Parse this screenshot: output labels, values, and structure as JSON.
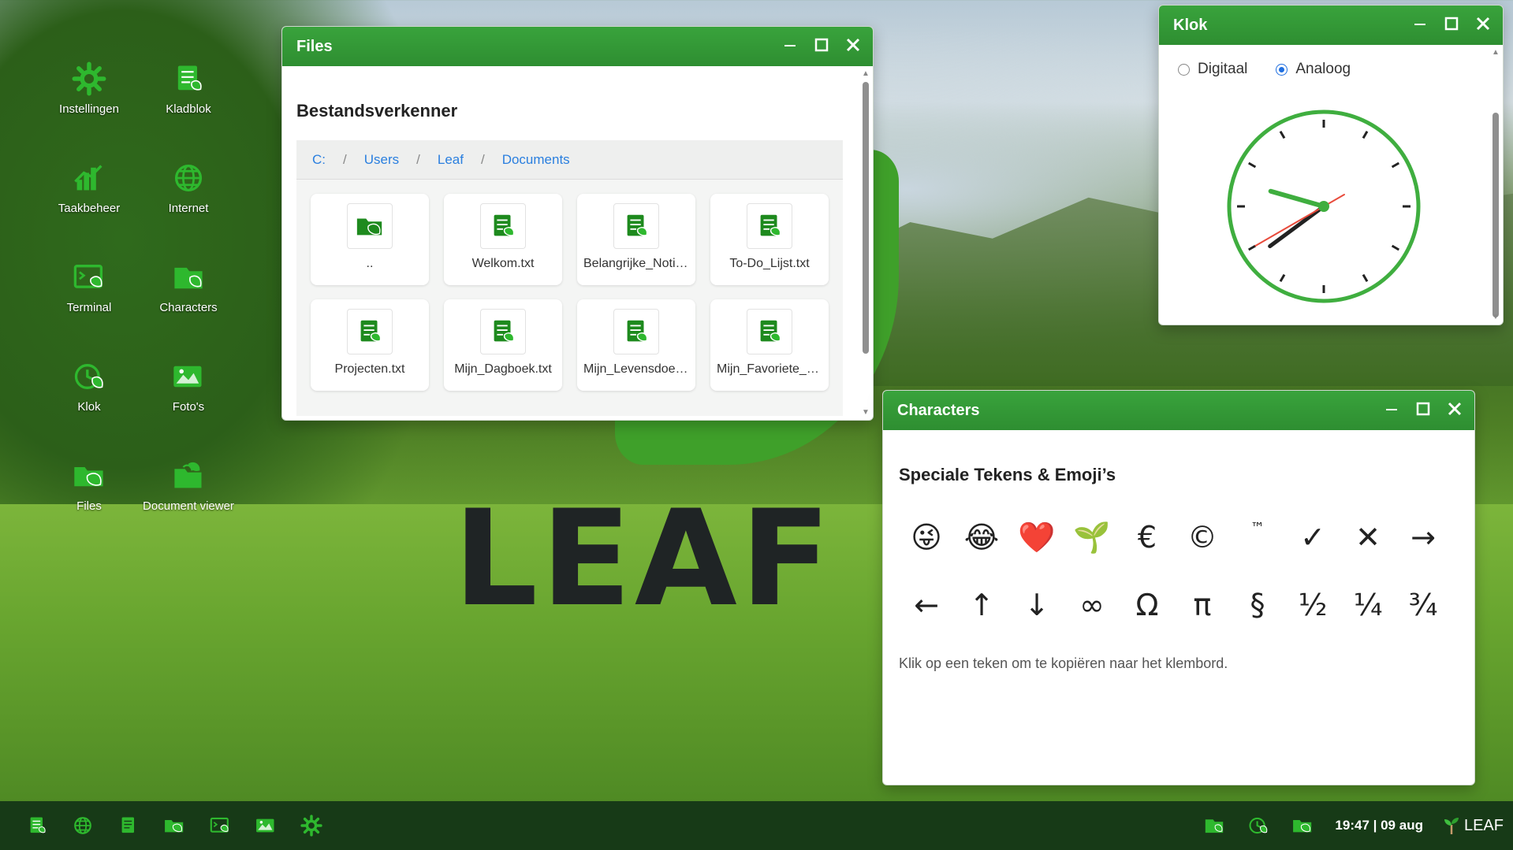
{
  "desktop": {
    "icons": [
      {
        "label": "Instellingen",
        "icon": "gear-icon"
      },
      {
        "label": "Kladblok",
        "icon": "notepad-icon"
      },
      {
        "label": "Taakbeheer",
        "icon": "chart-icon"
      },
      {
        "label": "Internet",
        "icon": "globe-icon"
      },
      {
        "label": "Terminal",
        "icon": "terminal-icon"
      },
      {
        "label": "Characters",
        "icon": "characters-icon"
      },
      {
        "label": "Klok",
        "icon": "clock-icon"
      },
      {
        "label": "Foto's",
        "icon": "photos-icon"
      },
      {
        "label": "Files",
        "icon": "folder-icon"
      },
      {
        "label": "Document viewer",
        "icon": "document-icon"
      }
    ],
    "logo_text": "LEAF O"
  },
  "files_window": {
    "title": "Files",
    "heading": "Bestandsverkenner",
    "breadcrumb": [
      "C:",
      "Users",
      "Leaf",
      "Documents"
    ],
    "items": [
      {
        "name": "..",
        "type": "folder"
      },
      {
        "name": "Welkom.txt",
        "type": "file"
      },
      {
        "name": "Belangrijke_Notities.txt",
        "type": "file"
      },
      {
        "name": "To-Do_Lijst.txt",
        "type": "file"
      },
      {
        "name": "Projecten.txt",
        "type": "file"
      },
      {
        "name": "Mijn_Dagboek.txt",
        "type": "file"
      },
      {
        "name": "Mijn_Levensdoelen.txt",
        "type": "file"
      },
      {
        "name": "Mijn_Favoriete_Dingen.txt",
        "type": "file"
      }
    ]
  },
  "clock_window": {
    "title": "Klok",
    "modes": [
      {
        "label": "Digitaal",
        "selected": false
      },
      {
        "label": "Analoog",
        "selected": true
      }
    ],
    "time": {
      "hour": 19,
      "minute": 47,
      "second": 40
    }
  },
  "characters_window": {
    "title": "Characters",
    "heading": "Speciale Tekens & Emoji’s",
    "chars": [
      "😜",
      "😂",
      "❤️",
      "🌱",
      "€",
      "©",
      "™",
      "✓",
      "✕",
      "→",
      "←",
      "↑",
      "↓",
      "∞",
      "Ω",
      "π",
      "§",
      "½",
      "¼",
      "¾"
    ],
    "hint": "Klik op een teken om te kopiëren naar het klembord."
  },
  "taskbar": {
    "apps": [
      "notepad-icon",
      "globe-icon",
      "notes-icon",
      "folder-icon",
      "terminal-icon",
      "photos-icon",
      "gear-icon"
    ],
    "tray": [
      "characters-icon",
      "clock-icon",
      "folder-icon"
    ],
    "clock": "19:47 | 09 aug",
    "brand": "LEAF"
  },
  "colors": {
    "accent": "#2e8e31",
    "icon_green": "#2eb82e",
    "taskbar": "#173a17",
    "link": "#2a7fdf"
  }
}
